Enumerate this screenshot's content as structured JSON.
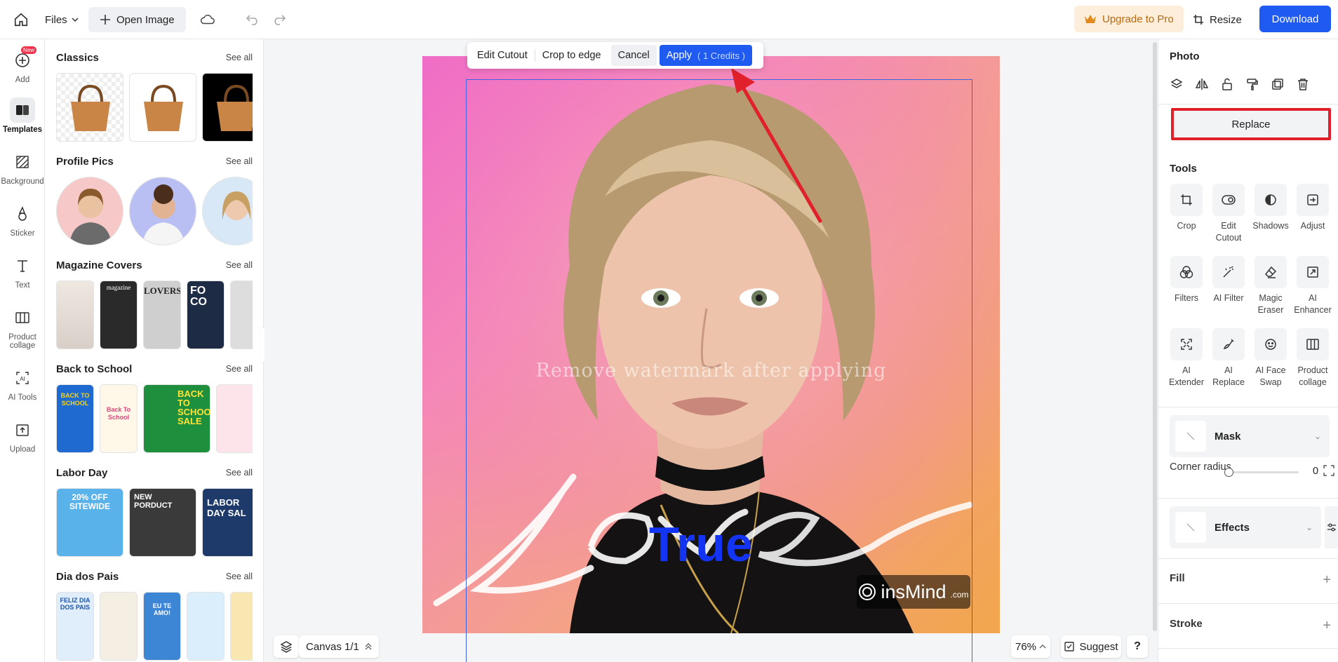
{
  "topbar": {
    "files_label": "Files",
    "open_image_label": "Open Image",
    "upgrade_label": "Upgrade to Pro",
    "resize_label": "Resize",
    "download_label": "Download"
  },
  "left_rail": {
    "items": [
      {
        "label": "Add",
        "badge": "New"
      },
      {
        "label": "Templates"
      },
      {
        "label": "Background"
      },
      {
        "label": "Sticker"
      },
      {
        "label": "Text"
      },
      {
        "label": "Product collage"
      },
      {
        "label": "AI Tools"
      },
      {
        "label": "Upload"
      }
    ]
  },
  "templates": {
    "see_all": "See all",
    "sections": [
      {
        "title": "Classics"
      },
      {
        "title": "Profile Pics"
      },
      {
        "title": "Magazine Covers"
      },
      {
        "title": "Back to School"
      },
      {
        "title": "Labor Day"
      },
      {
        "title": "Dia dos Pais"
      }
    ],
    "thumb_texts": {
      "magazine": "magazine",
      "lovers": "LOVERS",
      "foco": "FO CO",
      "bts_1": "BACK TO SCHOOL",
      "bts_2": "Back To School",
      "bts_3": "BACK TO SCHOOL SALE",
      "labor_1": "20% OFF SITEWIDE",
      "labor_2": "NEW PORDUCT",
      "labor_3": "LABOR DAY SAL",
      "pais_1": "FELIZ DIA DOS PAIS",
      "pais_3": "EU TE AMO!"
    }
  },
  "crop_toolbar": {
    "edit_cutout": "Edit Cutout",
    "crop_to_edge": "Crop to edge",
    "cancel": "Cancel",
    "apply": "Apply",
    "credits": "( 1 Credits )"
  },
  "artboard": {
    "watermark_text": "Remove watermark after applying",
    "true_text": "True",
    "brand": "insMind",
    "brand_suffix": ".com"
  },
  "canvas_footer": {
    "pager": "Canvas 1/1",
    "zoom": "76%",
    "suggest": "Suggest",
    "help": "?"
  },
  "right_panel": {
    "photo_title": "Photo",
    "replace_label": "Replace",
    "tools_title": "Tools",
    "tools": [
      {
        "label": "Crop",
        "icon": "crop-icon"
      },
      {
        "label": "Edit Cutout",
        "icon": "edit-cutout-icon"
      },
      {
        "label": "Shadows",
        "icon": "shadows-icon"
      },
      {
        "label": "Adjust",
        "icon": "adjust-icon"
      },
      {
        "label": "Filters",
        "icon": "filters-icon"
      },
      {
        "label": "AI Filter",
        "icon": "ai-filter-icon"
      },
      {
        "label": "Magic Eraser",
        "icon": "magic-eraser-icon"
      },
      {
        "label": "AI Enhancer",
        "icon": "ai-enhancer-icon"
      },
      {
        "label": "AI Extender",
        "icon": "ai-extender-icon"
      },
      {
        "label": "AI Replace",
        "icon": "ai-replace-icon"
      },
      {
        "label": "AI Face Swap",
        "icon": "ai-face-swap-icon"
      },
      {
        "label": "Product collage",
        "icon": "product-collage-icon"
      }
    ],
    "mask_label": "Mask",
    "corner_radius_label": "Corner radius",
    "corner_radius_value": "0",
    "corner_radius_level": 0,
    "effects_label": "Effects",
    "fill_label": "Fill",
    "stroke_label": "Stroke"
  },
  "colors": {
    "accent": "#1f5bf0",
    "upgrade_bg": "#fdeedb",
    "upgrade_text": "#b66a10",
    "highlight_box": "#e0202a",
    "annotation_arrow": "#e0202a",
    "selection": "#3d63e0"
  }
}
